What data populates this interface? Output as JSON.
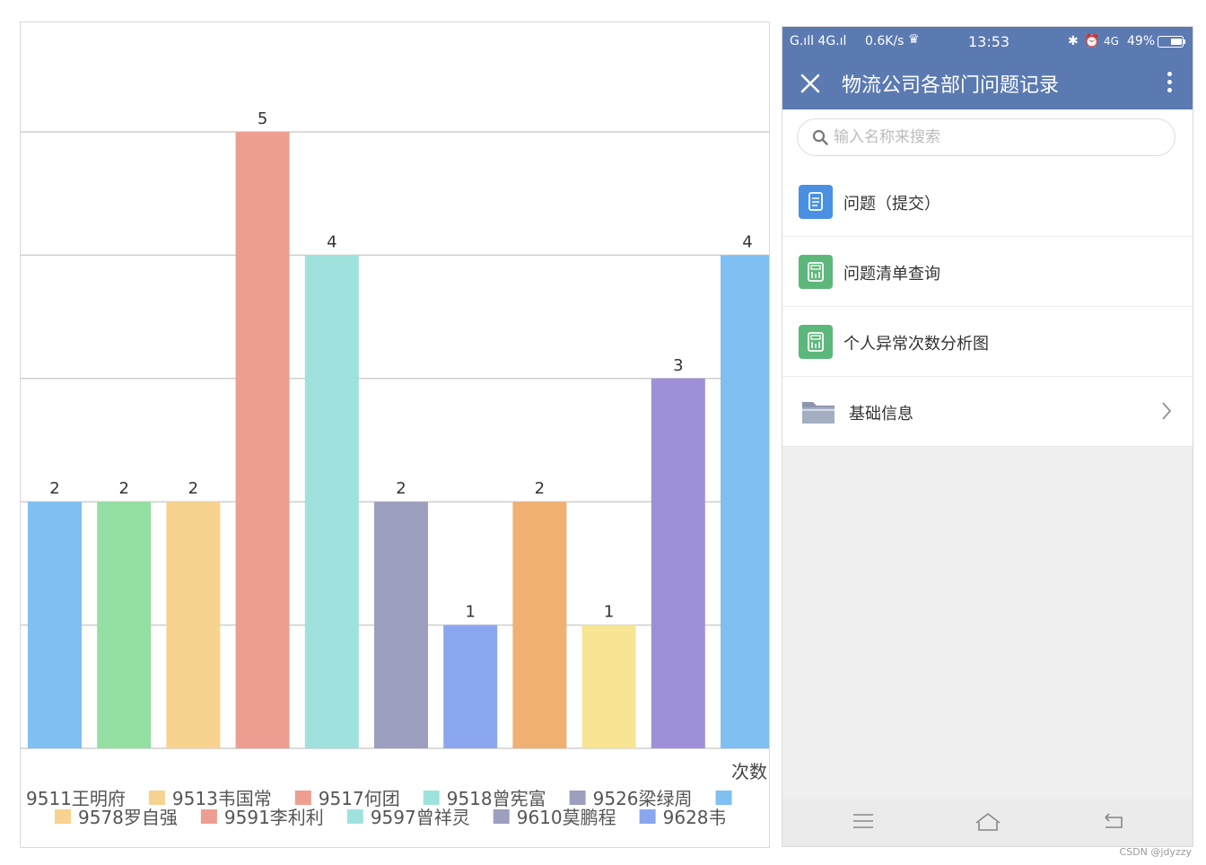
{
  "chart_data": {
    "type": "bar",
    "categories": [
      "9511王明府",
      "9513韦国常",
      "9517何团",
      "9518曾宪富",
      "9526梁绿周",
      "9578罗自强",
      "9591李利利",
      "9597曾祥灵",
      "9610莫鹏程",
      "9628韦"
    ],
    "values": [
      2,
      2,
      2,
      5,
      4,
      2,
      1,
      2,
      1,
      3,
      4
    ],
    "bar_colors": [
      "#7fbff2",
      "#93e0a2",
      "#f7d38f",
      "#ee9e91",
      "#9fe2dd",
      "#9c9fbd",
      "#8aa6ee",
      "#f0b072",
      "#f7e593",
      "#9f8fd8",
      "#7fbff2"
    ],
    "ylim": [
      0,
      5
    ],
    "grid": true,
    "unit_label": "次数",
    "legend": {
      "placement": "bottom",
      "row1": [
        "9511王明府",
        "9513韦国常",
        "9517何团",
        "9518曾宪富",
        "9526梁绿周"
      ],
      "row2": [
        "9578罗自强",
        "9591李利利",
        "9597曾祥灵",
        "9610莫鹏程",
        "9628韦"
      ],
      "row1_colors": [
        "#f7d38f",
        "#ee9e91",
        "#9fe2dd",
        "#9c9fbd",
        "#7fbff2"
      ],
      "row2_colors": [
        "#f7d38f",
        "#ee9e91",
        "#9fe2dd",
        "#9c9fbd",
        "#8aa6ee"
      ]
    }
  },
  "phone": {
    "status": {
      "signal": "G.ıll 4G.ıl",
      "speed": "0.6K/s",
      "time": "13:53",
      "battery": "49%",
      "network": "4G"
    },
    "title": "物流公司各部门问题记录",
    "search": {
      "placeholder": "输入名称来搜索"
    },
    "menu": [
      {
        "label": "问题（提交）",
        "icon": "document-icon",
        "color": "#4a90e2"
      },
      {
        "label": "问题清单查询",
        "icon": "calculator-icon",
        "color": "#5cb87a"
      },
      {
        "label": "个人异常次数分析图",
        "icon": "calculator-icon",
        "color": "#5cb87a"
      },
      {
        "label": "基础信息",
        "icon": "folder-icon",
        "color": "#8b96ad"
      }
    ]
  },
  "watermark": "CSDN @jdyzzy"
}
